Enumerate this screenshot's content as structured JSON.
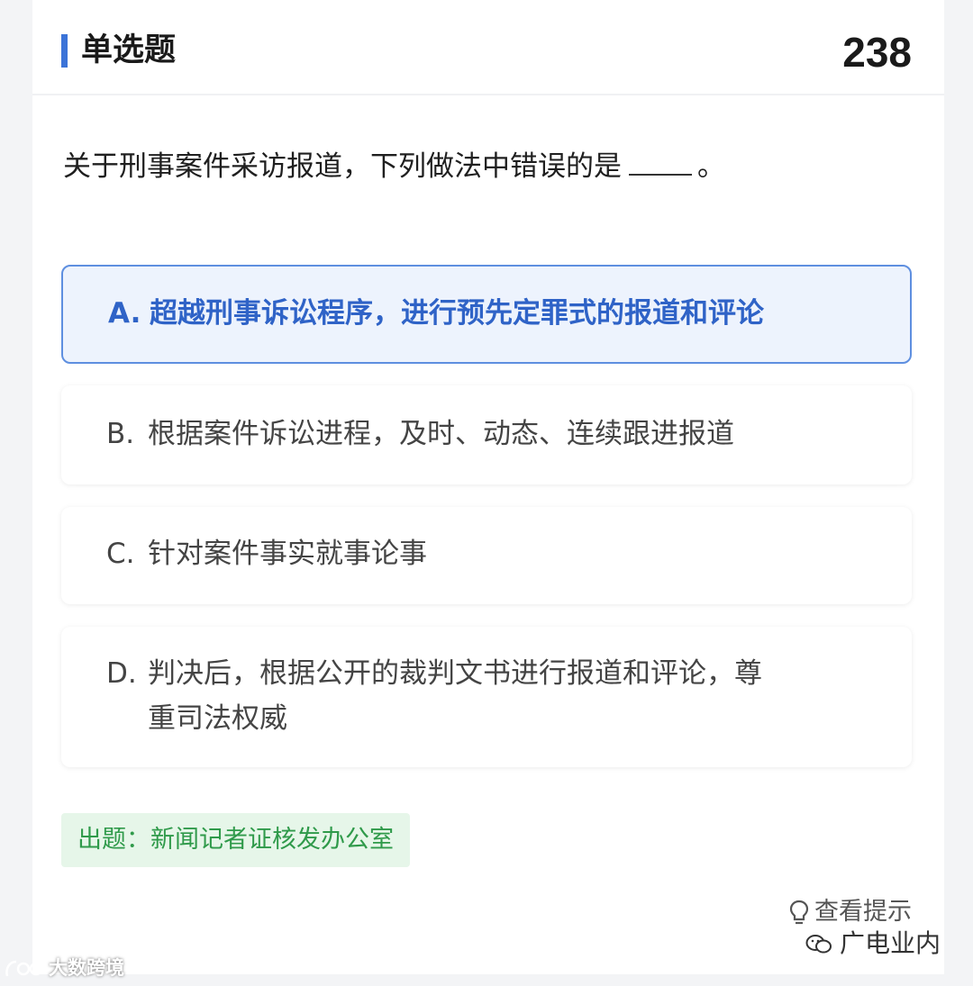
{
  "header": {
    "title": "单选题",
    "question_number": "238"
  },
  "question": {
    "text": "关于刑事案件采访报道，下列做法中错误的是",
    "end_punct": "。"
  },
  "options": [
    {
      "letter": "A.",
      "text": "超越刑事诉讼程序，进行预先定罪式的报道和评论",
      "selected": true
    },
    {
      "letter": "B.",
      "text": "根据案件诉讼进程，及时、动态、连续跟进报道",
      "selected": false
    },
    {
      "letter": "C.",
      "text": "针对案件事实就事论事",
      "selected": false
    },
    {
      "letter": "D.",
      "text_line1": "判决后，根据公开的裁判文书进行报道和评论，尊",
      "text_line2": "重司法权威",
      "selected": false
    }
  ],
  "source": {
    "label": "出题：",
    "value": "新闻记者证核发办公室"
  },
  "hint": {
    "label": "查看提示",
    "icon": "lightbulb-icon"
  },
  "watermarks": {
    "right": "广电业内",
    "left": "大数跨境"
  },
  "colors": {
    "accent": "#3b73d8",
    "selected_text": "#2f63c7",
    "selected_bg": "#edf3fd",
    "source_text": "#2f9a4a",
    "source_bg": "#e6f6e9"
  }
}
